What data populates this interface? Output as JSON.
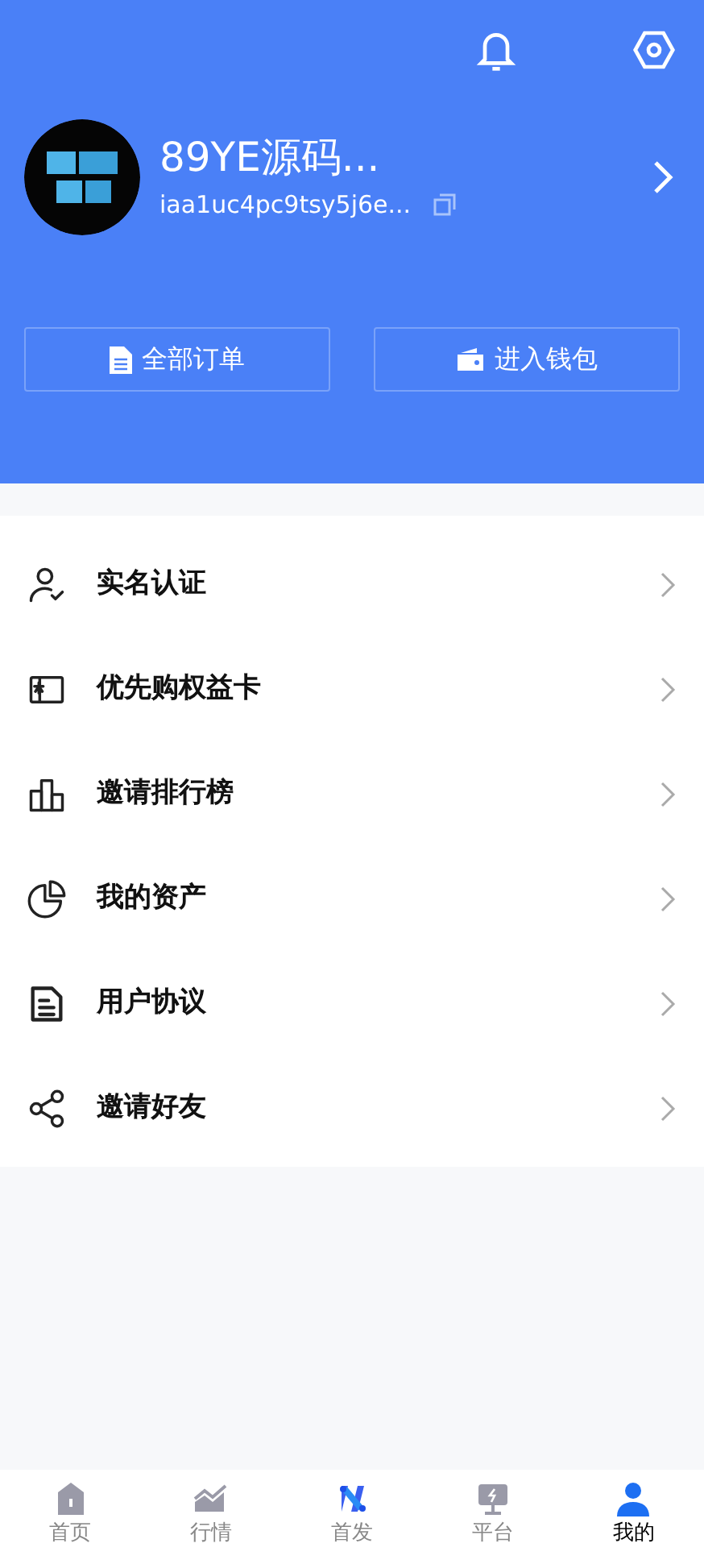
{
  "profile": {
    "name": "89YE源码...",
    "address": "iaa1uc4pc9tsy5j6e..."
  },
  "actions": [
    {
      "kind": "orders",
      "label": "全部订单"
    },
    {
      "kind": "wallet",
      "label": "进入钱包"
    }
  ],
  "menu": [
    {
      "kind": "verify",
      "label": "实名认证"
    },
    {
      "kind": "card",
      "label": "优先购权益卡"
    },
    {
      "kind": "ranking",
      "label": "邀请排行榜"
    },
    {
      "kind": "assets",
      "label": "我的资产"
    },
    {
      "kind": "agreement",
      "label": "用户协议"
    },
    {
      "kind": "share",
      "label": "邀请好友"
    }
  ],
  "tabs": [
    {
      "kind": "home",
      "label": "首页",
      "selected": false
    },
    {
      "kind": "market",
      "label": "行情",
      "selected": false
    },
    {
      "kind": "launch",
      "label": "首发",
      "selected": false
    },
    {
      "kind": "platform",
      "label": "平台",
      "selected": false
    },
    {
      "kind": "mine",
      "label": "我的",
      "selected": true
    }
  ]
}
